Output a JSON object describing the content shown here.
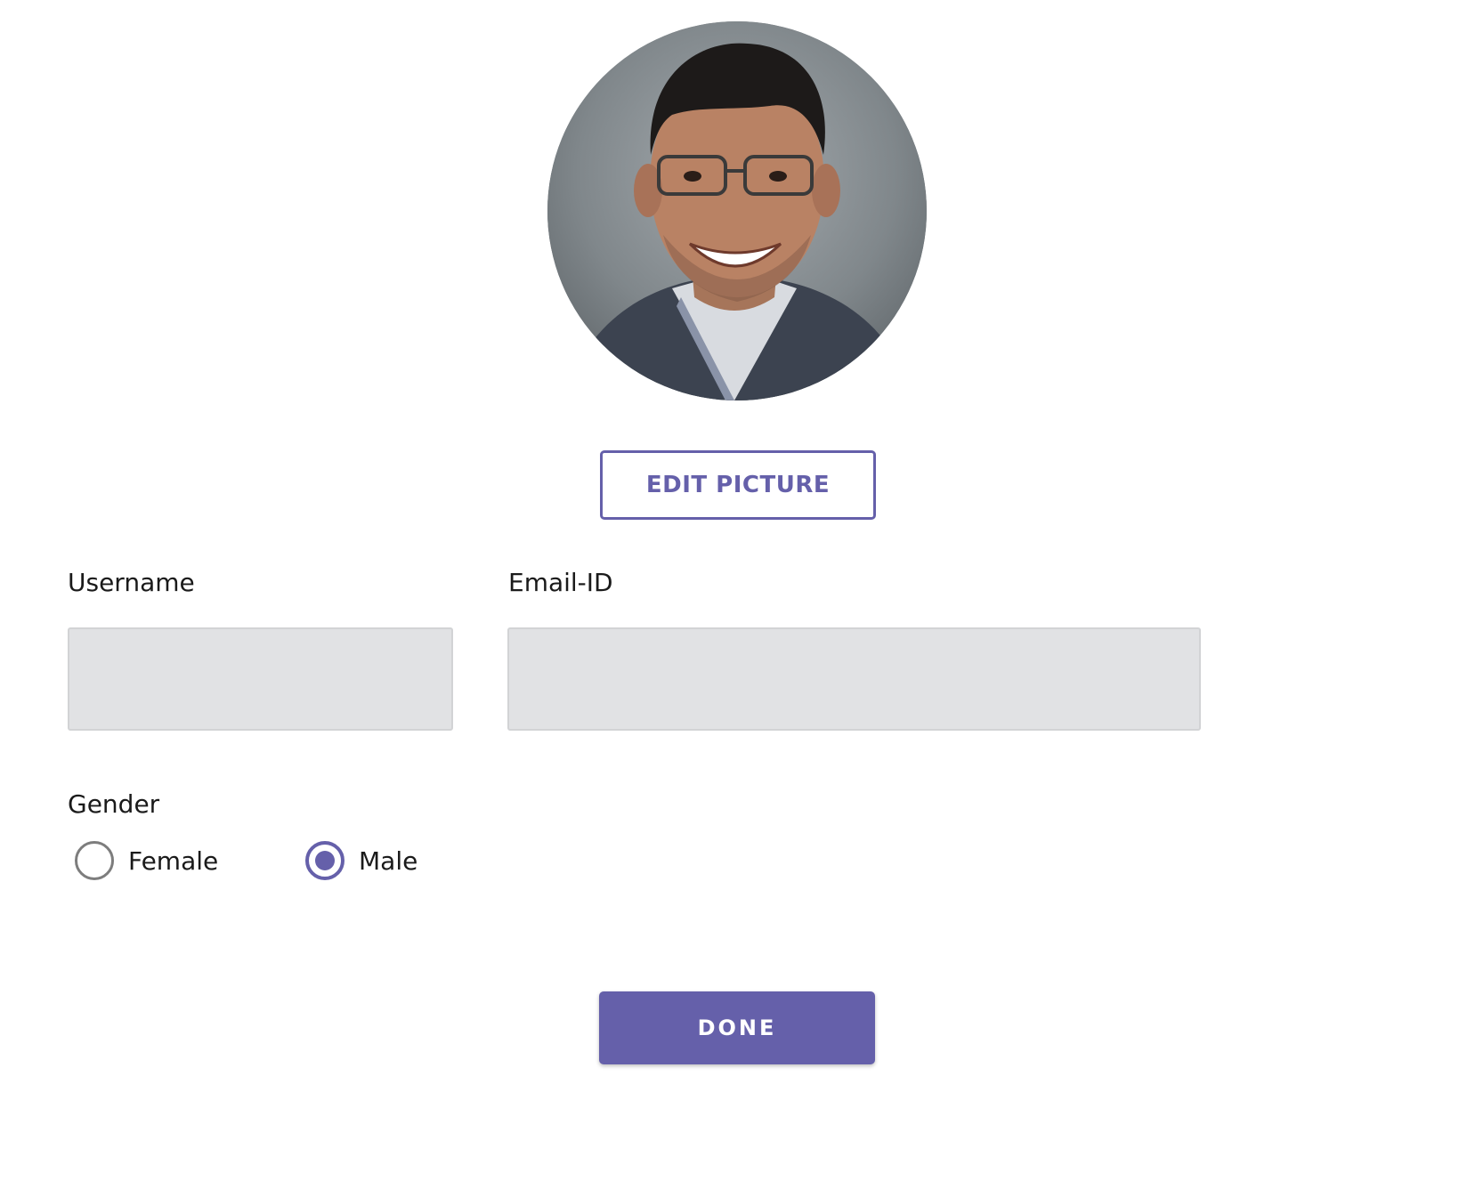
{
  "profile": {
    "avatar_alt": "",
    "edit_picture_label": "EDIT PICTURE"
  },
  "form": {
    "username": {
      "label": "Username",
      "value": "",
      "placeholder": ""
    },
    "email": {
      "label": "Email-ID",
      "value": "",
      "placeholder": ""
    },
    "gender": {
      "label": "Gender",
      "options": [
        {
          "label": "Female",
          "selected": false
        },
        {
          "label": "Male",
          "selected": true
        }
      ]
    }
  },
  "actions": {
    "done_label": "DONE"
  },
  "colors": {
    "accent": "#6560aa",
    "input_bg": "#e1e2e4",
    "radio_unchecked_border": "#7d7d7d"
  }
}
